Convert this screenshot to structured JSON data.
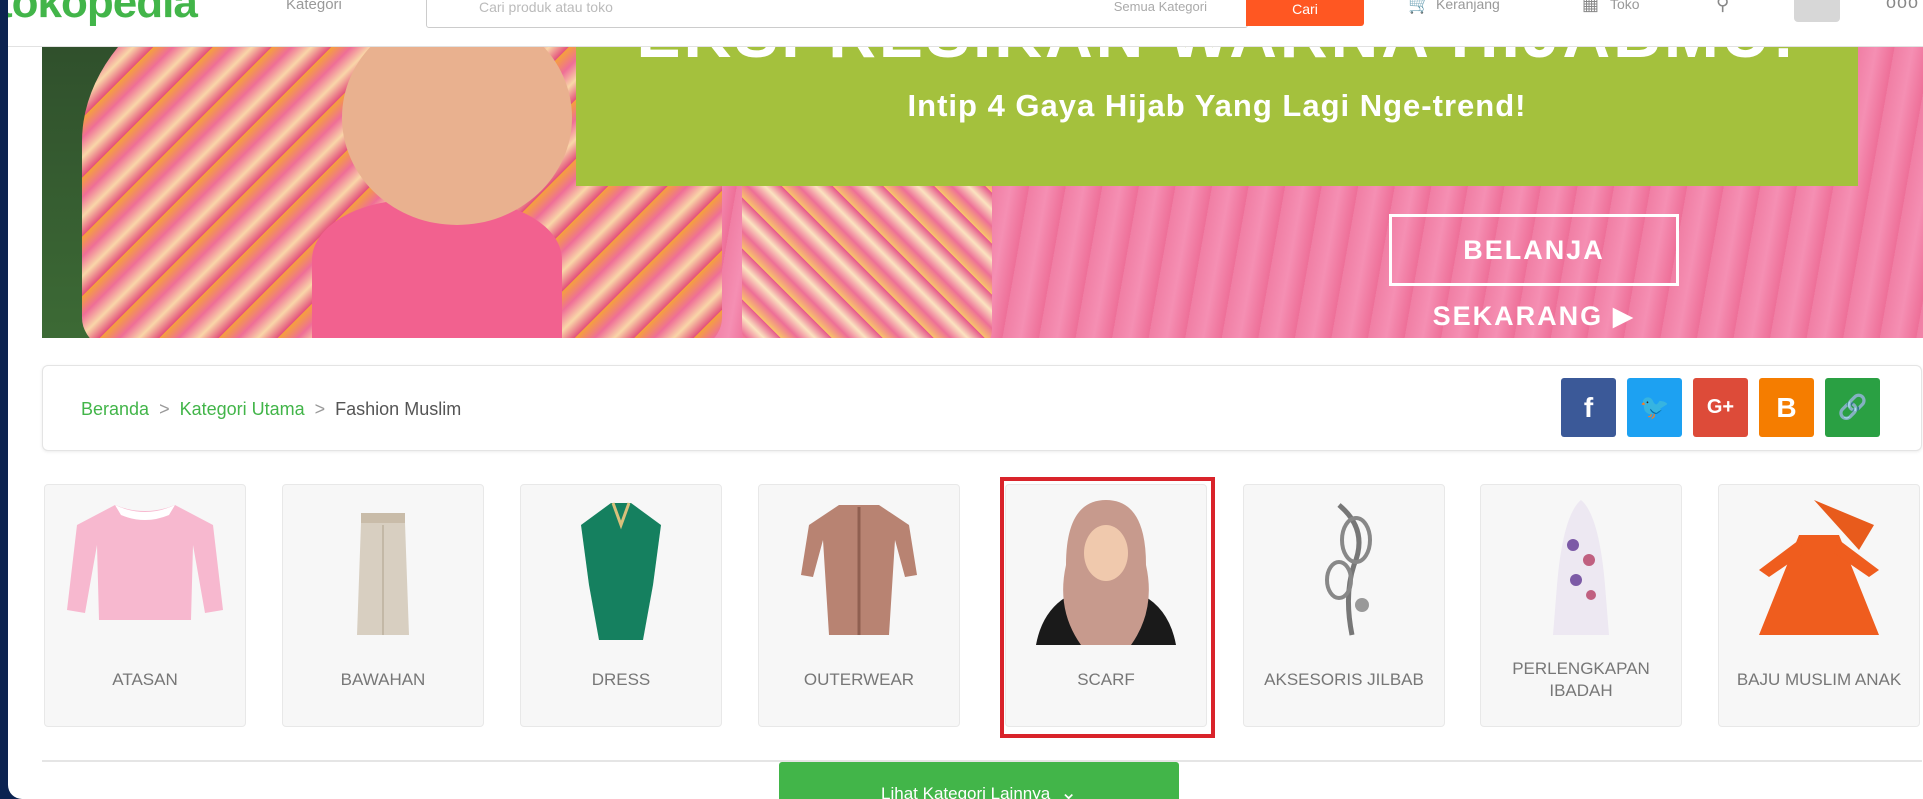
{
  "header": {
    "logo_text": "tokopedia",
    "category_label": "Kategori",
    "search_placeholder": "Cari produk atau toko",
    "search_scope": "Semua Kategori",
    "search_button": "Cari",
    "links": [
      "Keranjang",
      "Toko"
    ]
  },
  "banner": {
    "headline": "EKSPRESIKAN WARNA HIJABMU!",
    "subtitle": "Intip 4 Gaya Hijab Yang Lagi Nge-trend!",
    "cta": "BELANJA SEKARANG ▶"
  },
  "breadcrumb": {
    "items": [
      "Beranda",
      "Kategori Utama"
    ],
    "current": "Fashion Muslim",
    "separator": ">"
  },
  "share": [
    {
      "icon": "facebook-icon",
      "glyph": "f",
      "color": "#3b5998"
    },
    {
      "icon": "twitter-icon",
      "glyph": "🐦",
      "color": "#1da1f2"
    },
    {
      "icon": "google-plus-icon",
      "glyph": "G+",
      "color": "#dd4b39"
    },
    {
      "icon": "blogger-icon",
      "glyph": "B",
      "color": "#f57d00"
    },
    {
      "icon": "link-icon",
      "glyph": "🔗",
      "color": "#2aa043"
    }
  ],
  "categories": [
    {
      "label": "ATASAN",
      "icon": "pink-blouse-icon"
    },
    {
      "label": "BAWAHAN",
      "icon": "beige-skirt-icon"
    },
    {
      "label": "DRESS",
      "icon": "green-kaftan-icon"
    },
    {
      "label": "OUTERWEAR",
      "icon": "brown-cardigan-icon"
    },
    {
      "label": "SCARF",
      "icon": "hijab-model-icon"
    },
    {
      "label": "AKSESORIS JILBAB",
      "icon": "brooch-icon"
    },
    {
      "label": "PERLENGKAPAN IBADAH",
      "icon": "mukena-icon"
    },
    {
      "label": "BAJU MUSLIM ANAK",
      "icon": "kids-dress-icon"
    }
  ],
  "highlighted_category": "SCARF",
  "more_button": {
    "label": "Lihat Kategori Lainnya",
    "chevron": "⌄"
  },
  "colors": {
    "primary_green": "#42b549",
    "banner_green": "#a4c13d",
    "banner_pink": "#f07ea4",
    "highlight_red": "#d9232a",
    "search_orange": "#ff5722"
  }
}
